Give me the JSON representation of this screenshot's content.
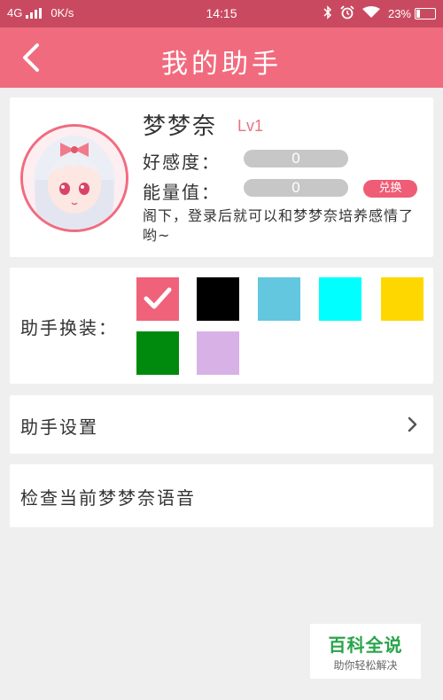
{
  "status_bar": {
    "network": "4G",
    "speed": "0K/s",
    "time": "14:15",
    "battery": "23%",
    "battery_level": 0.23,
    "icons": [
      "bluetooth-icon",
      "alarm-icon",
      "wifi-icon",
      "battery-icon"
    ]
  },
  "header": {
    "back_icon": "chevron-left-icon",
    "title": "我的助手"
  },
  "profile": {
    "name": "梦梦奈",
    "level": "Lv1",
    "affinity_label": "好感度：",
    "affinity_value": "0",
    "energy_label": "能量值：",
    "energy_value": "0",
    "exchange_label": "兑换",
    "hint": "阁下，登录后就可以和梦梦奈培养感情了哟~"
  },
  "outfit": {
    "label": "助手换装：",
    "swatches": [
      {
        "color": "#f0617a",
        "selected": true
      },
      {
        "color": "#000000",
        "selected": false
      },
      {
        "color": "#63c7df",
        "selected": false
      },
      {
        "color": "#00ffff",
        "selected": false
      },
      {
        "color": "#ffd700",
        "selected": false
      },
      {
        "color": "#008a0d",
        "selected": false
      },
      {
        "color": "#d8b2e6",
        "selected": false
      }
    ]
  },
  "settings": {
    "label": "助手设置",
    "icon": "chevron-right-icon"
  },
  "voice": {
    "label": "检查当前梦梦奈语音"
  },
  "watermark": {
    "title": "百科全说",
    "subtitle": "助你轻松解决"
  },
  "colors": {
    "status_bar": "#c94a60",
    "header": "#f16b7e",
    "accent": "#ef5c75",
    "bar_gray": "#c7c7c7",
    "watermark_green": "#2aa44a"
  }
}
